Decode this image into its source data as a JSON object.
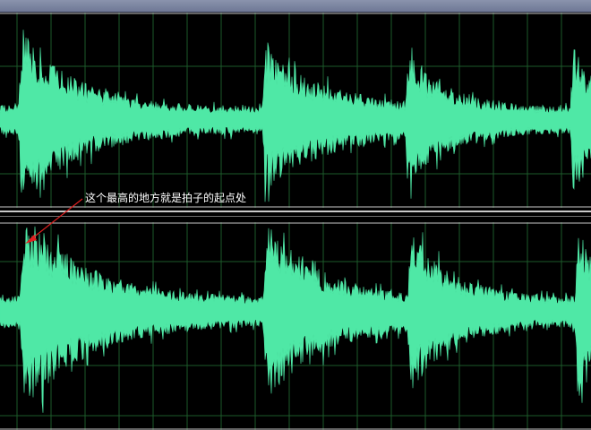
{
  "colors": {
    "background": "#000000",
    "waveform": "#4fe8a6",
    "grid": "#1d5a2a",
    "channel_border": "#c8c8c8",
    "title_bar": "#7d85a0",
    "annotation_text": "#ffffff",
    "annotation_arrow": "#e02020"
  },
  "annotation": {
    "text": "这个最高的地方就是拍子的起点处"
  },
  "icons": {
    "annotation_arrow": "arrow-icon"
  }
}
